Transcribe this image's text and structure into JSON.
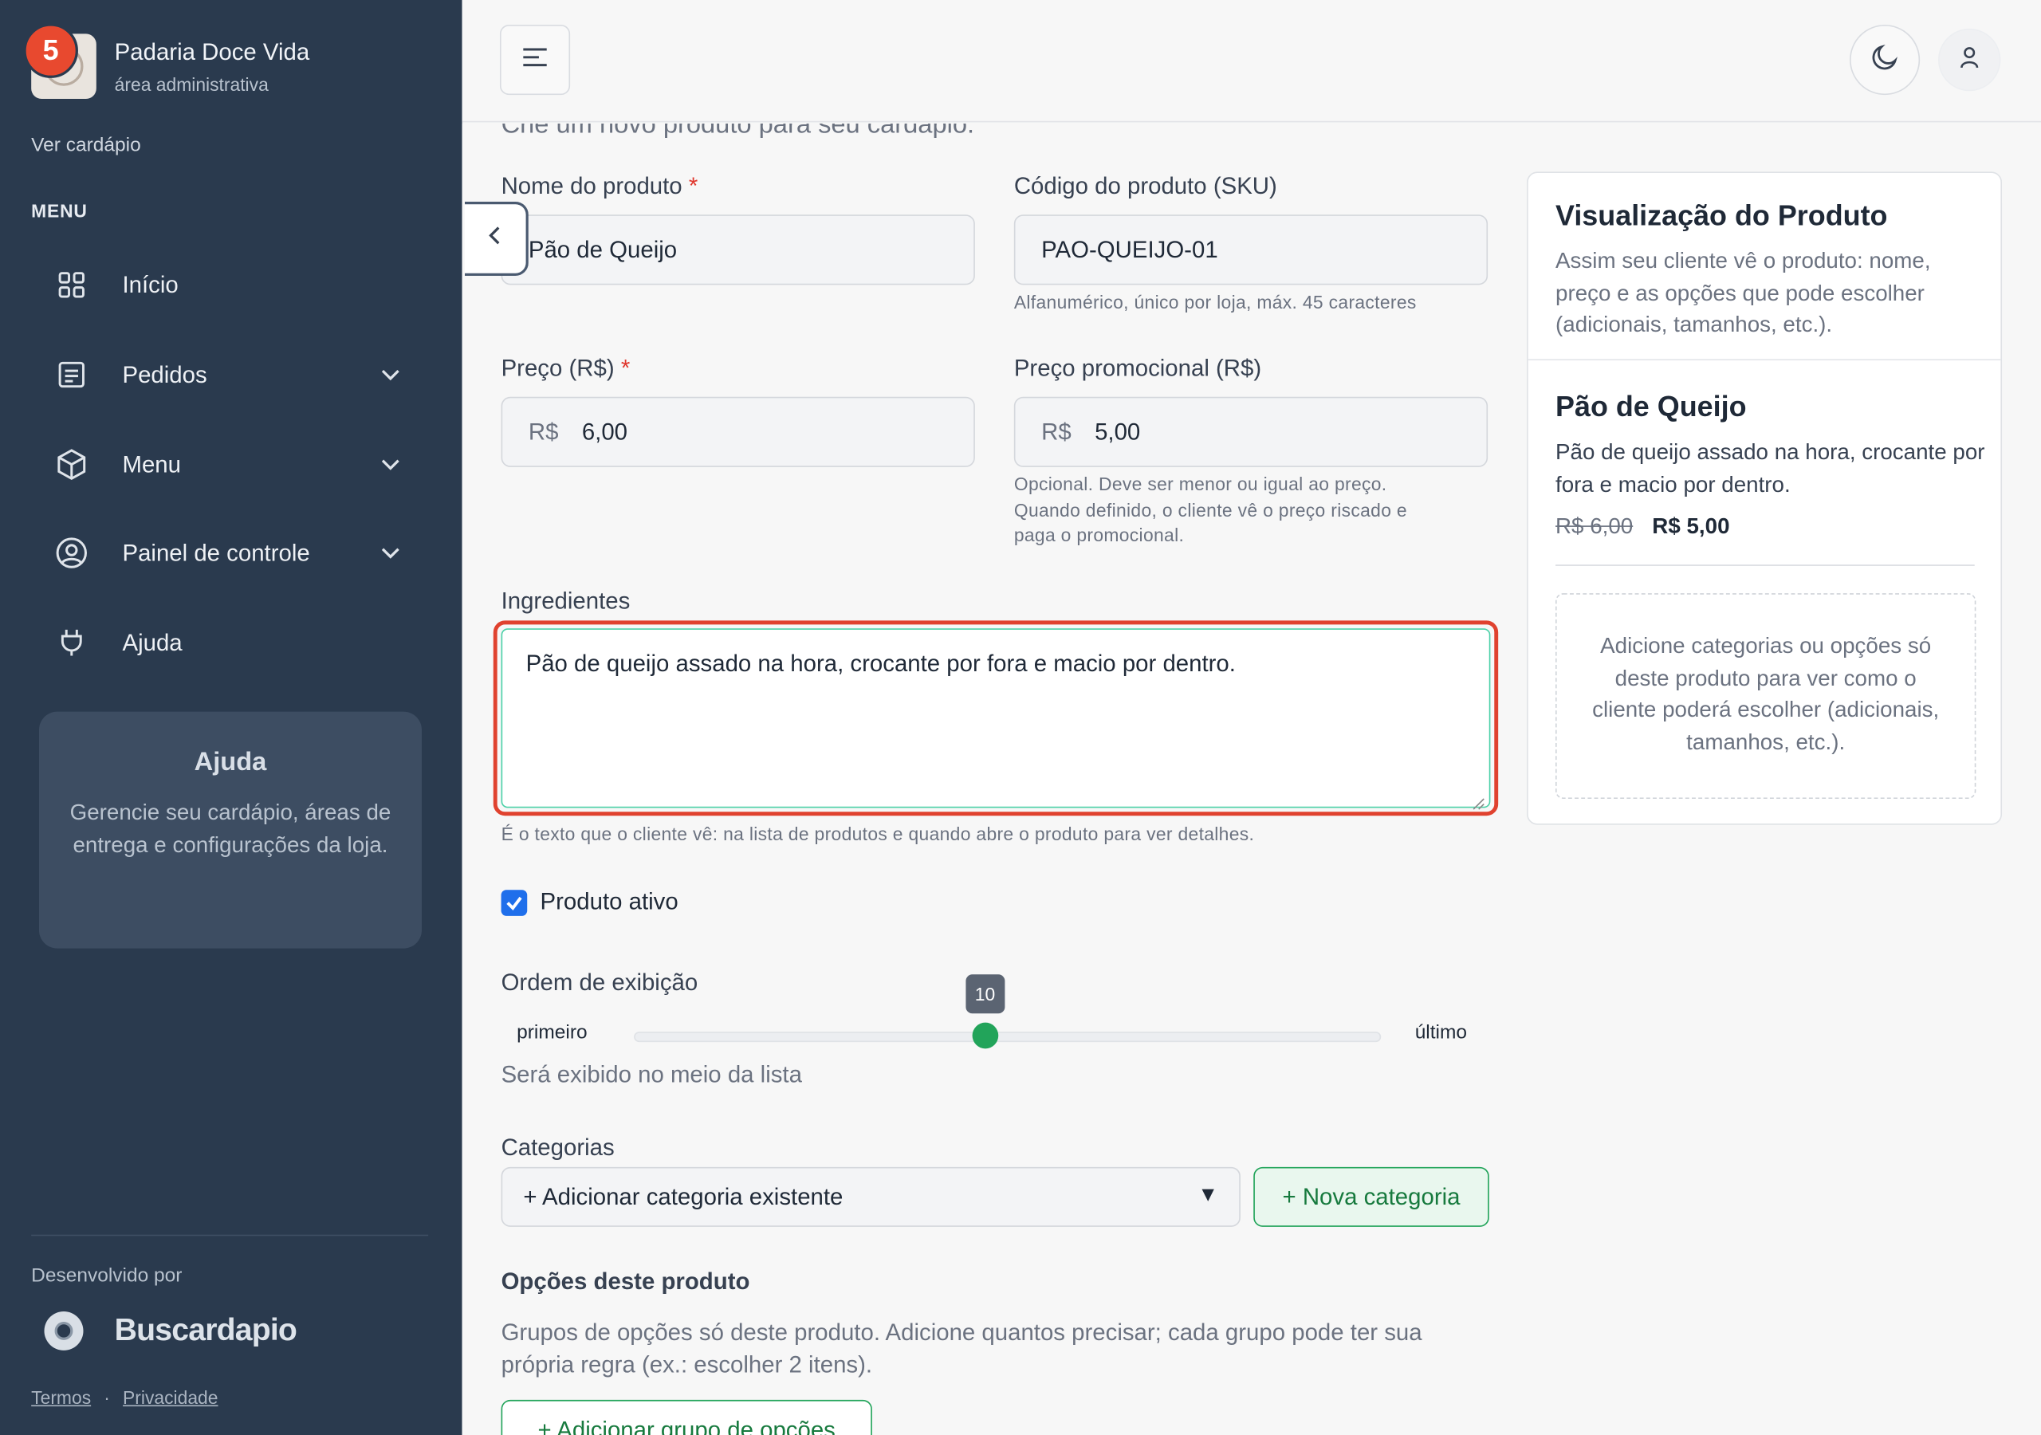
{
  "sidebar": {
    "badge_count": "5",
    "brand_name": "Padaria Doce Vida",
    "brand_subtitle": "área administrativa",
    "view_menu_link": "Ver cardápio",
    "menu_title": "MENU",
    "items": [
      {
        "label": "Início",
        "icon": "grid-icon"
      },
      {
        "label": "Pedidos",
        "icon": "receipt-icon"
      },
      {
        "label": "Menu",
        "icon": "box-icon"
      },
      {
        "label": "Painel de controle",
        "icon": "user-circle-icon"
      },
      {
        "label": "Ajuda",
        "icon": "plug-icon"
      }
    ],
    "help_card": {
      "title": "Ajuda",
      "text": "Gerencie seu cardápio, áreas de entrega e configurações da loja."
    },
    "developed_by": "Desenvolvido por",
    "developer_name": "Buscardapio",
    "terms": "Termos",
    "separator": "·",
    "privacy": "Privacidade"
  },
  "form": {
    "subtitle": "Crie um novo produto para seu cardápio.",
    "name_label": "Nome do produto",
    "name_value": "Pão de Queijo",
    "sku_label": "Código do produto (SKU)",
    "sku_value": "PAO-QUEIJO-01",
    "sku_hint": "Alfanumérico, único por loja, máx. 45 caracteres",
    "price_label": "Preço (R$)",
    "currency_prefix": "R$",
    "price_value": "6,00",
    "promo_label": "Preço promocional (R$)",
    "promo_value": "5,00",
    "promo_hint_1": "Opcional. Deve ser menor ou igual ao preço.",
    "promo_hint_2": "Quando definido, o cliente vê o preço riscado e",
    "promo_hint_3": "paga o promocional.",
    "required_mark": "*",
    "ingredients_label": "Ingredientes",
    "ingredients_value": "Pão de queijo assado na hora, crocante por fora e macio por dentro.",
    "ingredients_hint": "É o texto que o cliente vê: na lista de produtos e quando abre o produto para ver detalhes.",
    "active_label": "Produto ativo",
    "active_checked": true,
    "order_label": "Ordem de exibição",
    "order_value": "10",
    "order_position_fraction": 0.47,
    "order_min": "primeiro",
    "order_max": "último",
    "order_hint": "Será exibido no meio da lista",
    "categories_label": "Categorias",
    "categories_select": "+ Adicionar categoria existente",
    "new_category_button": "+ Nova categoria",
    "options_title": "Opções deste produto",
    "options_desc": "Grupos de opções só deste produto. Adicione quantos precisar; cada grupo pode ter sua própria regra (ex.: escolher 2 itens).",
    "add_group_button": "+ Adicionar grupo de opções"
  },
  "preview": {
    "title": "Visualização do Produto",
    "description": "Assim seu cliente vê o produto: nome, preço e as opções que pode escolher (adicionais, tamanhos, etc.).",
    "product_name": "Pão de Queijo",
    "product_ingredients": "Pão de queijo assado na hora, crocante por fora e macio por dentro.",
    "old_price": "R$ 6,00",
    "new_price": "R$ 5,00",
    "empty_text": "Adicione categorias ou opções só deste produto para ver como o cliente poderá escolher (adicionais, tamanhos, etc.)."
  },
  "colors": {
    "sidebar_bg": "#2a3a4e",
    "accent_green": "#22a45a",
    "focus_red": "#e0422f",
    "badge_red": "#e8492f"
  }
}
